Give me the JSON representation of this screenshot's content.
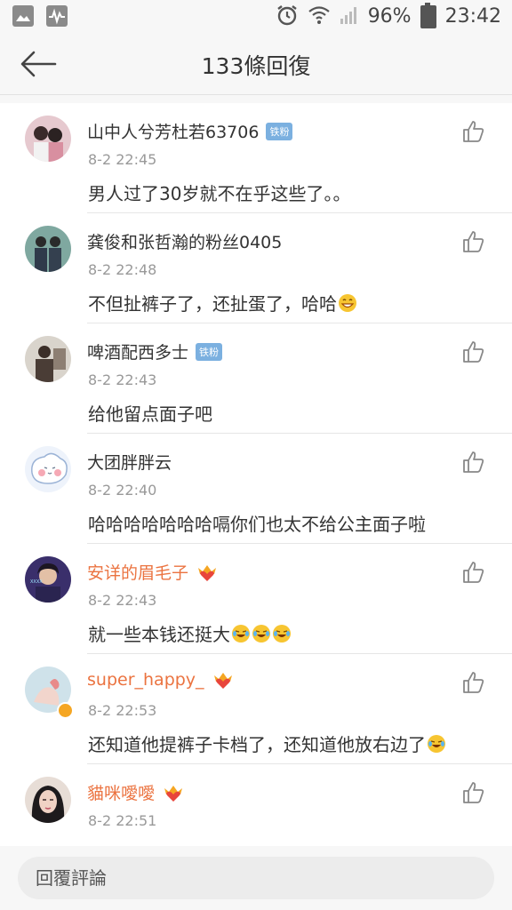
{
  "status_bar": {
    "left_icons": [
      "image-icon",
      "activity-icon"
    ],
    "alarm_icon": "alarm-icon",
    "wifi_icon": "wifi-icon",
    "signal_icon": "signal-icon",
    "battery": "96%",
    "time": "23:42"
  },
  "header": {
    "back_icon": "arrow-left-icon",
    "title": "133條回復"
  },
  "comments": [
    {
      "username": "山中人兮芳杜若63706",
      "badge": "铁粉",
      "vip": false,
      "time": "8-2 22:45",
      "text": "男人过了30岁就不在乎这些了。。",
      "emoji_count": 0
    },
    {
      "username": "龚俊和张哲瀚的粉丝0405",
      "badge": "",
      "vip": false,
      "time": "8-2 22:48",
      "text": "不但扯裤子了，还扯蛋了，哈哈",
      "emoji_count": 1,
      "emoji": "grin-emoji"
    },
    {
      "username": "啤酒配西多士",
      "badge": "铁粉",
      "vip": false,
      "time": "8-2 22:43",
      "text": "给他留点面子吧",
      "emoji_count": 0
    },
    {
      "username": "大团胖胖云",
      "badge": "",
      "vip": false,
      "time": "8-2 22:40",
      "text": "哈哈哈哈哈哈哈嗝你们也太不给公主面子啦",
      "emoji_count": 0
    },
    {
      "username": "安详的眉毛子",
      "badge": "",
      "vip": true,
      "time": "8-2 22:43",
      "text": "就一些本钱还挺大",
      "emoji_count": 3,
      "emoji": "laugh-cry-emoji"
    },
    {
      "username": "super_happy_",
      "badge": "",
      "vip": true,
      "time": "8-2 22:53",
      "text": "还知道他提裤子卡档了，还知道他放右边了",
      "emoji_count": 1,
      "emoji": "laugh-cry-emoji"
    },
    {
      "username": "貓咪噯噯",
      "badge": "",
      "vip": true,
      "time": "8-2 22:51",
      "text": "",
      "emoji_count": 0
    }
  ],
  "like_icon": "thumbs-up-icon",
  "vip_icon": "crown-heart-icon",
  "footer": {
    "reply_placeholder": "回覆評論"
  },
  "colors": {
    "vip_name": "#eb7340",
    "fan_badge": "#7bb0e0",
    "time": "#999999",
    "background": "#f7f7f7"
  }
}
